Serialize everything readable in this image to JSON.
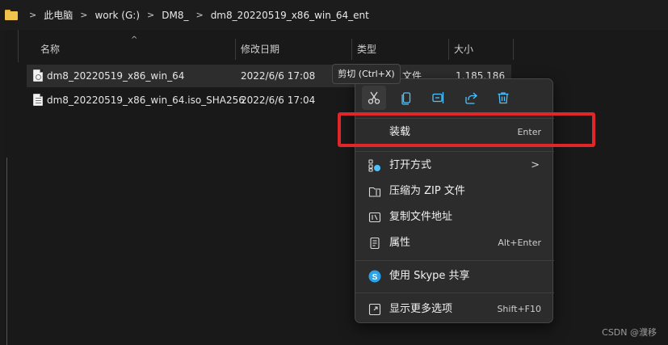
{
  "breadcrumb": {
    "items": [
      "此电脑",
      "work (G:)",
      "DM8_",
      "dm8_20220519_x86_win_64_ent"
    ],
    "separator": ">"
  },
  "columns": [
    "名称",
    "修改日期",
    "类型",
    "大小"
  ],
  "sort_arrow": "^",
  "files": [
    {
      "name": "dm8_20220519_x86_win_64",
      "date": "2022/6/6 17:08",
      "type": "文件",
      "size": "1,185,186"
    },
    {
      "name": "dm8_20220519_x86_win_64.iso_SHA256",
      "date": "2022/6/6 17:04",
      "type": "",
      "size": ""
    }
  ],
  "tooltip": "剪切 (Ctrl+X)",
  "quick_actions": [
    "cut-icon",
    "copy-icon",
    "rename-icon",
    "share-icon",
    "delete-icon"
  ],
  "menu": {
    "mount": {
      "label": "装载",
      "shortcut": "Enter"
    },
    "open_with": {
      "label": "打开方式",
      "chevron": ">"
    },
    "compress": {
      "label": "压缩为 ZIP 文件"
    },
    "copy_path": {
      "label": "复制文件地址"
    },
    "properties": {
      "label": "属性",
      "shortcut": "Alt+Enter"
    },
    "skype": {
      "label": "使用 Skype 共享"
    },
    "more": {
      "label": "显示更多选项",
      "shortcut": "Shift+F10"
    }
  },
  "watermark": "CSDN @濮移",
  "colors": {
    "highlight_box": "#e1262a",
    "background": "#191919",
    "menu_bg": "#2c2c2c",
    "folder": "#f0c44c",
    "accent": "#4cc2ff"
  }
}
